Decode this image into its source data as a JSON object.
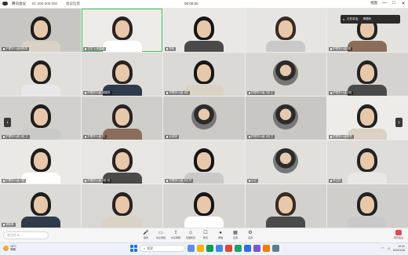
{
  "topbar": {
    "app_name": "腾讯会议",
    "meeting_id": "ID: 000 000 000",
    "info_label": "会议信息",
    "timer": "00:00:00",
    "layout_label": "视图",
    "minimize": "—",
    "maximize": "□",
    "close": "✕"
  },
  "speaker_panel": {
    "text": "正在讲话：",
    "name": "周德利"
  },
  "tiles": [
    {
      "label": "护理学21级班助学"
    },
    {
      "label": "王宇飞 何嘉颖"
    },
    {
      "label": "李彤"
    },
    {
      "label": ""
    },
    {
      "label": "护理学21级2班"
    },
    {
      "label": ""
    },
    {
      "label": "护理学21级 胡嘉琪"
    },
    {
      "label": "护理学21级 4班"
    },
    {
      "label": "护理学21级 7班 王"
    },
    {
      "label": "护理学24级 2班"
    },
    {
      "label": "护理学21级 3班 王"
    },
    {
      "label": "护理学21级 刘"
    },
    {
      "label": "赵瑞琪"
    },
    {
      "label": "护理学21级 3班 王"
    },
    {
      "label": "护理学21级陈思"
    },
    {
      "label": "护理学21级 1班"
    },
    {
      "label": "护理学21级 2班 何"
    },
    {
      "label": "护理学21级 3班 李"
    },
    {
      "label": "小云"
    },
    {
      "label": "李佳蕊"
    },
    {
      "label": "胡晓琳"
    },
    {
      "label": ""
    },
    {
      "label": ""
    },
    {
      "label": ""
    },
    {
      "label": ""
    }
  ],
  "toolbar": {
    "chat_placeholder": "说点什么...",
    "buttons": [
      {
        "label": "静音",
        "icon": "microphone-icon"
      },
      {
        "label": "停止视频",
        "icon": "video-icon"
      },
      {
        "label": "共享屏幕",
        "icon": "share-screen-icon"
      },
      {
        "label": "管理成员",
        "icon": "members-icon"
      },
      {
        "label": "聊天",
        "icon": "chat-icon"
      },
      {
        "label": "录制",
        "icon": "record-icon"
      },
      {
        "label": "应用",
        "icon": "apps-icon"
      },
      {
        "label": "设置",
        "icon": "settings-icon"
      }
    ],
    "leave_label": "离开会议"
  },
  "taskbar": {
    "weather_temp": "18°C",
    "weather_desc": "晴朗",
    "search_placeholder": "搜索",
    "time": "19:31",
    "date": "2023/11/5"
  },
  "colors": {
    "active_speaker": "#43c35e",
    "leave": "#e5484d",
    "start": "#1a73e8"
  }
}
